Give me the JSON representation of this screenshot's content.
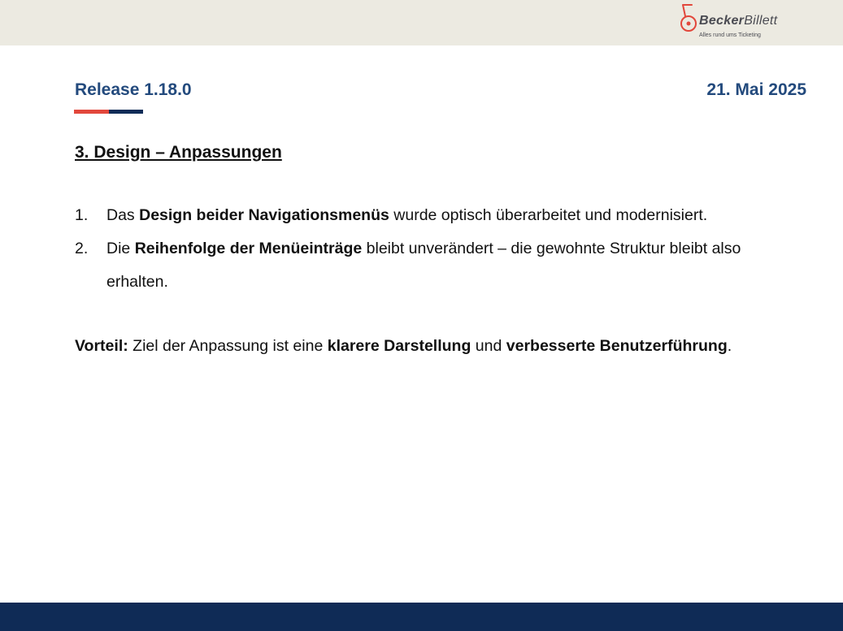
{
  "brand": {
    "name_part1": "Becker",
    "name_part2": "Billett",
    "tagline": "Alles rund ums Ticketing",
    "colors": {
      "red": "#e2473b",
      "navy": "#102c57",
      "gray": "#4a4b52"
    }
  },
  "header": {
    "release": "Release 1.18.0",
    "date": "21. Mai 2025"
  },
  "section": {
    "heading": "3. Design – Anpassungen"
  },
  "items": [
    {
      "num": "1.",
      "pre": "Das ",
      "bold": "Design beider Navigationsmenüs",
      "post": " wurde optisch überarbeitet und modernisiert."
    },
    {
      "num": "2.",
      "pre": "Die ",
      "bold": "Reihenfolge der Menüeinträge",
      "post": " bleibt unverändert – die gewohnte Struktur bleibt also erhalten."
    }
  ],
  "vorteil": {
    "label": "Vorteil:",
    "t1": " Ziel der Anpassung ist eine ",
    "b1": "klarere Darstellung",
    "t2": " und ",
    "b2": "verbesserte Benutzerführung",
    "t3": "."
  },
  "colors": {
    "topbar": "#eceae1",
    "heading_blue": "#234a7d",
    "footer": "#0f2b56"
  }
}
